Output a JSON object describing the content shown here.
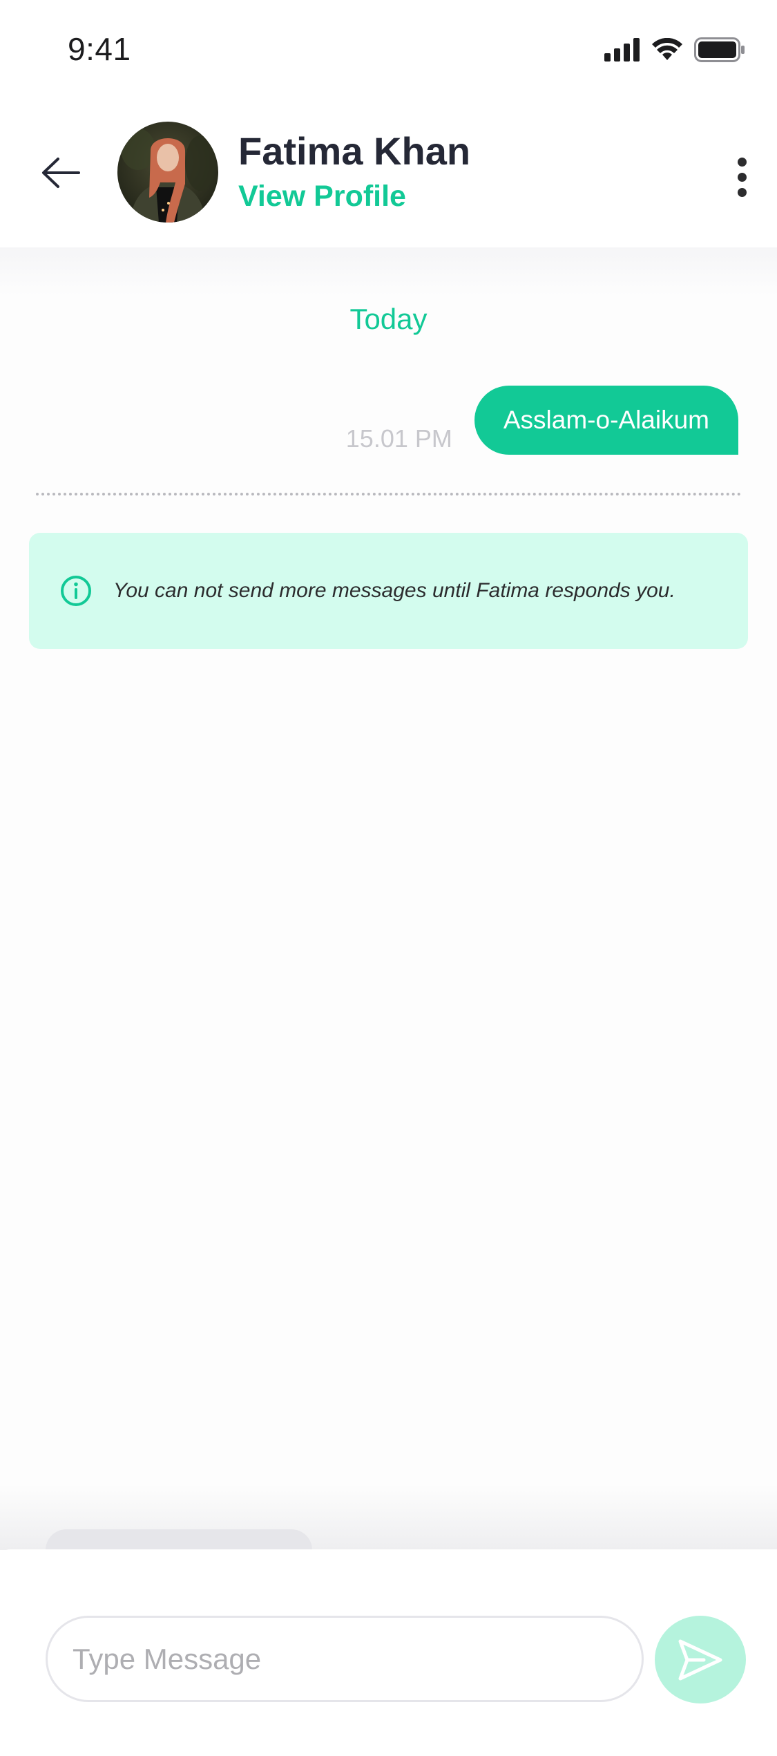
{
  "status_bar": {
    "time": "9:41",
    "icons": [
      "signal-icon",
      "wifi-icon",
      "battery-icon"
    ]
  },
  "header": {
    "back_icon": "back-arrow-icon",
    "contact_name": "Fatima Khan",
    "view_profile_label": "View Profile",
    "more_icon": "more-vertical-icon"
  },
  "chat": {
    "date_label": "Today",
    "messages": [
      {
        "text": "Asslam-o-Alaikum",
        "time": "15.01 PM",
        "direction": "outgoing"
      }
    ],
    "info_banner": {
      "icon": "info-icon",
      "text": "You can not send more messages until Fatima responds you."
    }
  },
  "composer": {
    "placeholder": "Type Message",
    "value": "",
    "send_icon": "send-icon"
  },
  "colors": {
    "accent": "#12c996",
    "banner_bg": "#d3fcee",
    "send_button_disabled": "#b5f3dd"
  }
}
